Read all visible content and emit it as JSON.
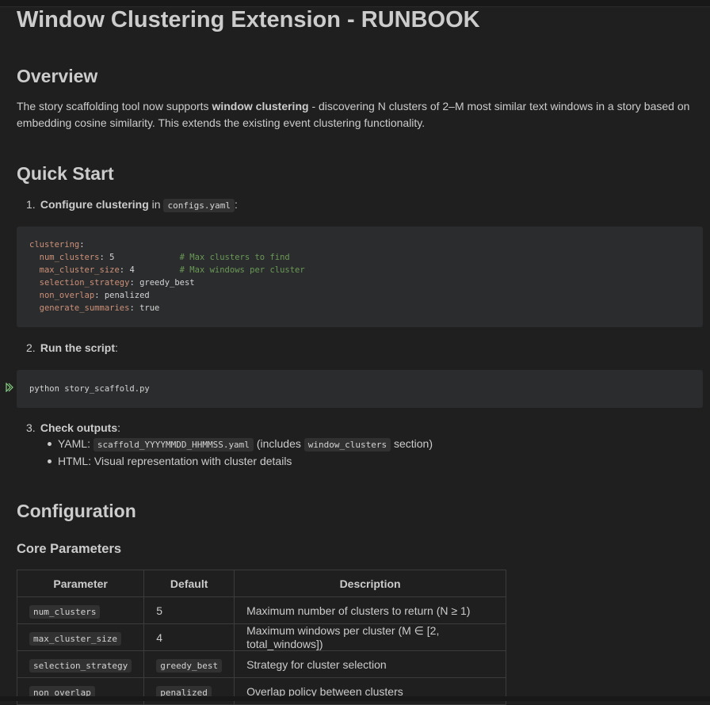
{
  "title": "Window Clustering Extension - RUNBOOK",
  "overview": {
    "heading": "Overview",
    "text_before": "The story scaffolding tool now supports ",
    "bold": "window clustering",
    "text_after": " - discovering N clusters of 2–M most similar text windows in a story based on embedding cosine similarity. This extends the existing event clustering functionality."
  },
  "quick_start": {
    "heading": "Quick Start",
    "step1": {
      "num": "1.",
      "bold": "Configure clustering",
      "mid": " in ",
      "code": "configs.yaml",
      "tail": ":"
    },
    "step2": {
      "num": "2.",
      "bold": "Run the script",
      "tail": ":"
    },
    "step3": {
      "num": "3.",
      "bold": "Check outputs",
      "tail": ":"
    },
    "yaml_block": {
      "root": "clustering",
      "lines": [
        {
          "key": "num_clusters",
          "value": "5",
          "comment": "# Max clusters to find"
        },
        {
          "key": "max_cluster_size",
          "value": "4",
          "comment": "# Max windows per cluster"
        },
        {
          "key": "selection_strategy",
          "value": "greedy_best",
          "comment": ""
        },
        {
          "key": "non_overlap",
          "value": "penalized",
          "comment": ""
        },
        {
          "key": "generate_summaries",
          "value": "true",
          "comment": ""
        }
      ]
    },
    "run_command": "python story_scaffold.py",
    "outputs": {
      "yaml_label": "YAML: ",
      "yaml_code": "scaffold_YYYYMMDD_HHMMSS.yaml",
      "yaml_mid": " (includes ",
      "yaml_code2": "window_clusters",
      "yaml_tail": " section)",
      "html_item": "HTML: Visual representation with cluster details"
    }
  },
  "configuration": {
    "heading": "Configuration",
    "core_heading": "Core Parameters",
    "table": {
      "headers": [
        "Parameter",
        "Default",
        "Description"
      ],
      "rows": [
        {
          "param": "num_clusters",
          "default": "5",
          "default_is_code": false,
          "desc": "Maximum number of clusters to return (N ≥ 1)"
        },
        {
          "param": "max_cluster_size",
          "default": "4",
          "default_is_code": false,
          "desc": "Maximum windows per cluster (M ∈ [2, total_windows])"
        },
        {
          "param": "selection_strategy",
          "default": "greedy_best",
          "default_is_code": true,
          "desc": "Strategy for cluster selection"
        },
        {
          "param": "non_overlap",
          "default": "penalized",
          "default_is_code": true,
          "desc": "Overlap policy between clusters"
        }
      ]
    }
  },
  "icons": {
    "run": "run-cell-icon"
  }
}
